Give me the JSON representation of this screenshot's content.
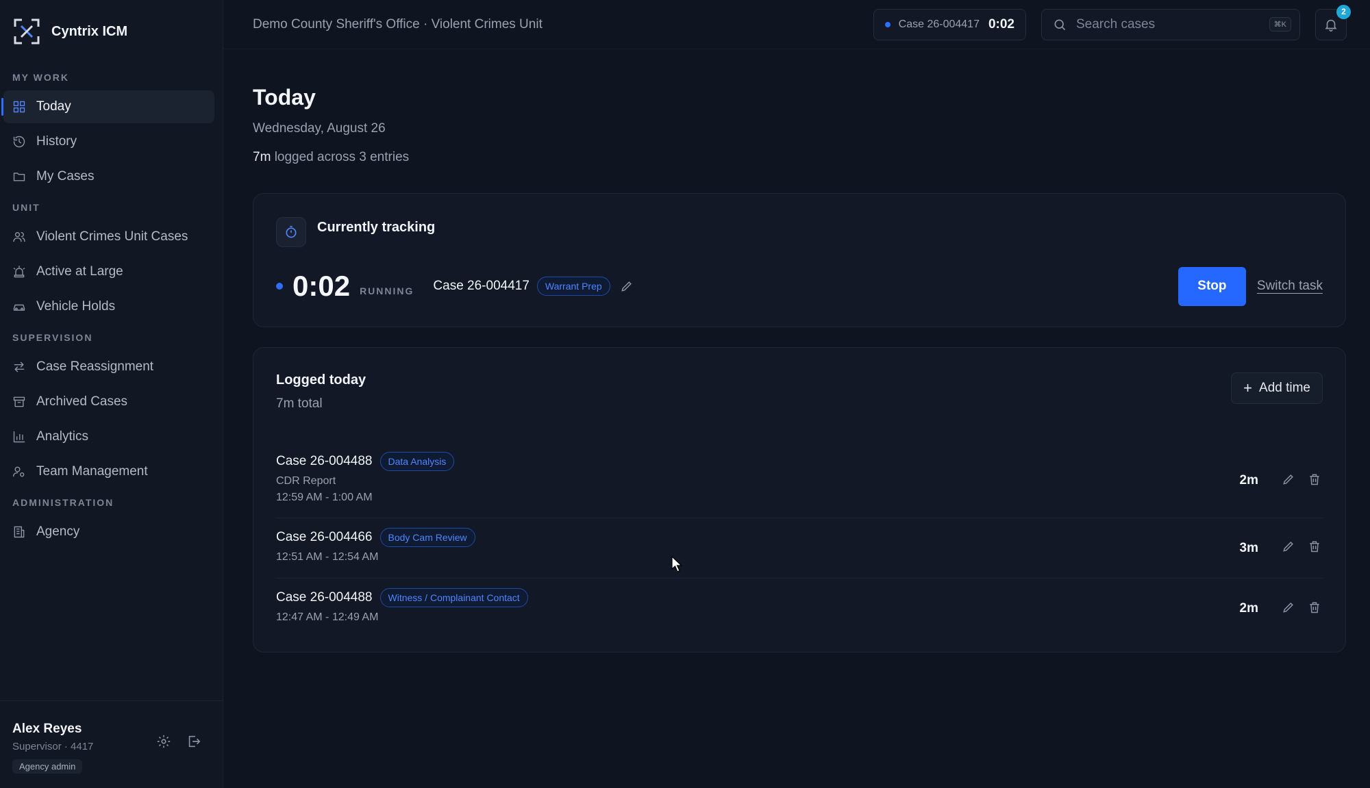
{
  "app": {
    "name": "Cyntrix ICM"
  },
  "sidebar": {
    "sections": [
      {
        "title": "MY WORK",
        "items": [
          {
            "label": "Today",
            "icon": "grid-icon",
            "active": true
          },
          {
            "label": "History",
            "icon": "history-icon",
            "active": false
          },
          {
            "label": "My Cases",
            "icon": "folder-icon",
            "active": false
          }
        ]
      },
      {
        "title": "UNIT",
        "items": [
          {
            "label": "Violent Crimes Unit Cases",
            "icon": "users-icon",
            "active": false
          },
          {
            "label": "Active at Large",
            "icon": "siren-icon",
            "active": false
          },
          {
            "label": "Vehicle Holds",
            "icon": "car-icon",
            "active": false
          }
        ]
      },
      {
        "title": "SUPERVISION",
        "items": [
          {
            "label": "Case Reassignment",
            "icon": "swap-icon",
            "active": false
          },
          {
            "label": "Archived Cases",
            "icon": "archive-icon",
            "active": false
          },
          {
            "label": "Analytics",
            "icon": "bar-chart-icon",
            "active": false
          },
          {
            "label": "Team Management",
            "icon": "user-gear-icon",
            "active": false
          }
        ]
      },
      {
        "title": "ADMINISTRATION",
        "items": [
          {
            "label": "Agency",
            "icon": "building-icon",
            "active": false
          }
        ]
      }
    ],
    "user": {
      "name": "Alex Reyes",
      "role": "Supervisor · 4417",
      "badge": "Agency admin"
    }
  },
  "topbar": {
    "breadcrumb": "Demo County Sheriff's Office · Violent Crimes Unit",
    "timer_case": "Case 26-004417",
    "timer_time": "0:02",
    "search_placeholder": "Search cases",
    "search_shortcut": "⌘K",
    "notification_count": "2"
  },
  "page": {
    "title": "Today",
    "date": "Wednesday, August 26",
    "summary_amount": "7m",
    "summary_text": "logged across 3 entries"
  },
  "tracking": {
    "title": "Currently tracking",
    "time": "0:02",
    "state": "RUNNING",
    "case": "Case 26-004417",
    "tag": "Warrant Prep",
    "stop_label": "Stop",
    "switch_label": "Switch task"
  },
  "logged": {
    "title": "Logged today",
    "total": "7m total",
    "add_label": "Add time",
    "entries": [
      {
        "case": "Case 26-004488",
        "tag": "Data Analysis",
        "note": "CDR Report",
        "times": "12:59 AM - 1:00 AM",
        "duration": "2m"
      },
      {
        "case": "Case 26-004466",
        "tag": "Body Cam Review",
        "note": "",
        "times": "12:51 AM - 12:54 AM",
        "duration": "3m"
      },
      {
        "case": "Case 26-004488",
        "tag": "Witness / Complainant Contact",
        "note": "",
        "times": "12:47 AM - 12:49 AM",
        "duration": "2m"
      }
    ]
  },
  "colors": {
    "accent": "#2468ff",
    "background": "#0e1420",
    "sidebar": "#111723",
    "card": "#121826"
  }
}
